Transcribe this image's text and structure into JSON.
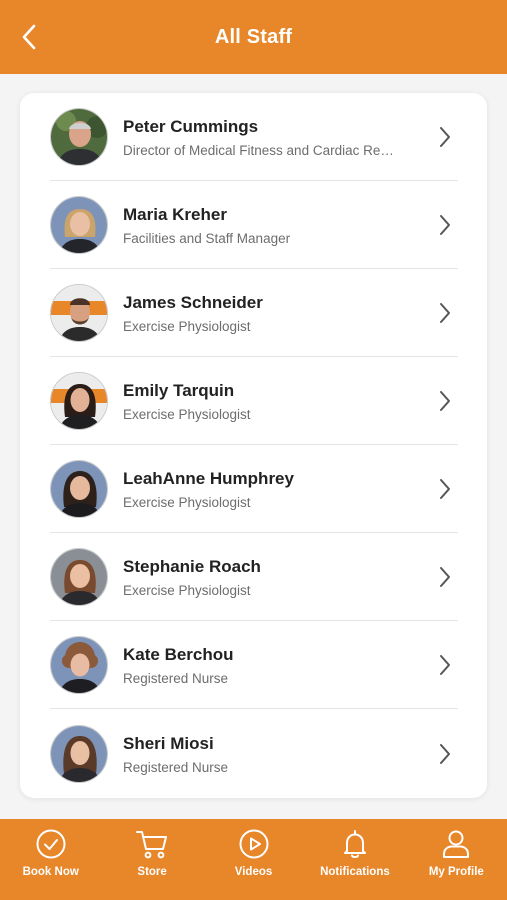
{
  "header": {
    "title": "All Staff",
    "back_icon": "chevron-left-icon"
  },
  "colors": {
    "accent": "#e8862a",
    "background": "#f4f4f4",
    "card": "#ffffff"
  },
  "staff": [
    {
      "name": "Peter Cummings",
      "role": "Director of Medical Fitness and Cardiac Re…"
    },
    {
      "name": "Maria Kreher",
      "role": "Facilities and Staff Manager"
    },
    {
      "name": "James Schneider",
      "role": "Exercise Physiologist"
    },
    {
      "name": "Emily Tarquin",
      "role": "Exercise Physiologist"
    },
    {
      "name": "LeahAnne Humphrey",
      "role": "Exercise Physiologist"
    },
    {
      "name": "Stephanie Roach",
      "role": "Exercise Physiologist"
    },
    {
      "name": "Kate Berchou",
      "role": "Registered Nurse"
    },
    {
      "name": "Sheri Miosi",
      "role": "Registered Nurse"
    }
  ],
  "tabbar": [
    {
      "label": "Book Now",
      "icon": "check-circle-icon"
    },
    {
      "label": "Store",
      "icon": "cart-icon"
    },
    {
      "label": "Videos",
      "icon": "play-circle-icon"
    },
    {
      "label": "Notifications",
      "icon": "bell-icon"
    },
    {
      "label": "My Profile",
      "icon": "person-icon"
    }
  ]
}
